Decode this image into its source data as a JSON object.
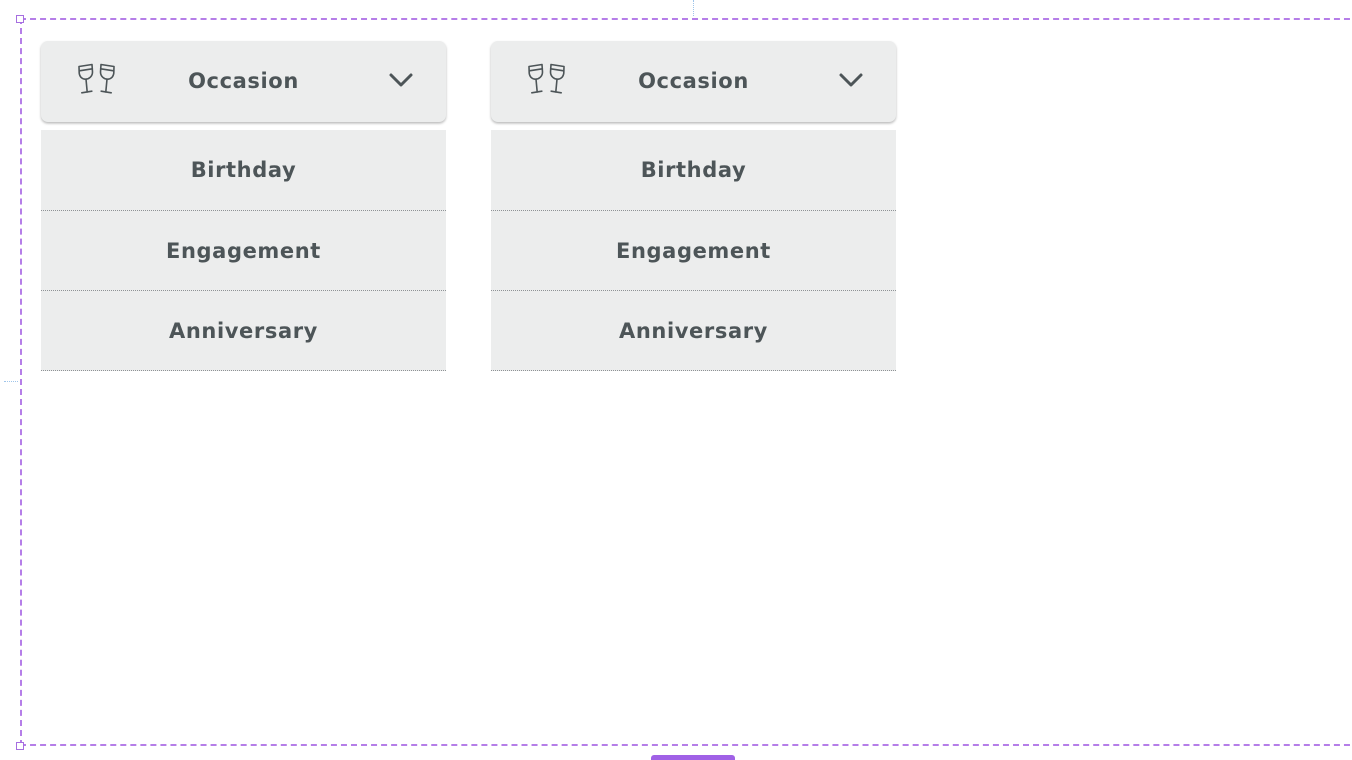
{
  "dropdowns": [
    {
      "label": "Occasion",
      "icon": "wine-glasses-icon",
      "toggle_icon": "chevron-down-icon",
      "items": [
        {
          "label": "Birthday"
        },
        {
          "label": "Engagement"
        },
        {
          "label": "Anniversary"
        }
      ]
    },
    {
      "label": "Occasion",
      "icon": "wine-glasses-icon",
      "toggle_icon": "chevron-down-icon",
      "items": [
        {
          "label": "Birthday"
        },
        {
          "label": "Engagement"
        },
        {
          "label": "Anniversary"
        }
      ]
    }
  ],
  "colors": {
    "widget_background": "#eceded",
    "text": "#4d5558",
    "selection_frame": "#b57ee8",
    "guide": "#9fc5ea"
  }
}
